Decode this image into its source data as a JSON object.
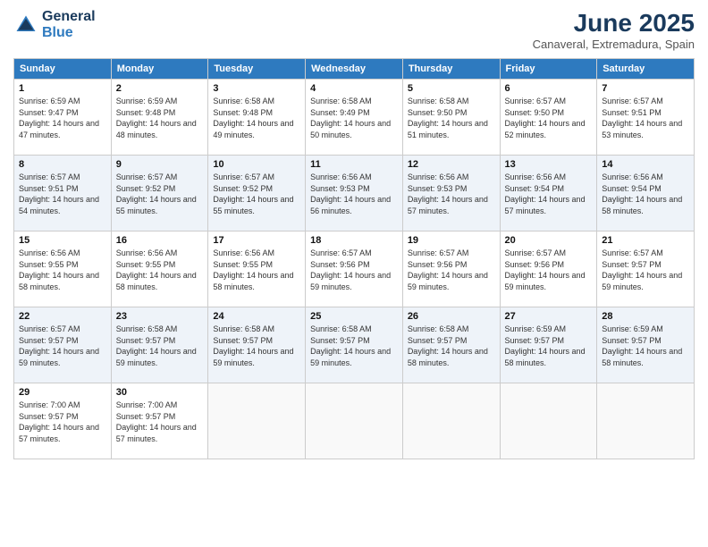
{
  "logo": {
    "line1": "General",
    "line2": "Blue"
  },
  "title": "June 2025",
  "location": "Canaveral, Extremadura, Spain",
  "headers": [
    "Sunday",
    "Monday",
    "Tuesday",
    "Wednesday",
    "Thursday",
    "Friday",
    "Saturday"
  ],
  "weeks": [
    [
      {
        "day": "1",
        "sunrise": "6:59 AM",
        "sunset": "9:47 PM",
        "daylight": "14 hours and 47 minutes."
      },
      {
        "day": "2",
        "sunrise": "6:59 AM",
        "sunset": "9:48 PM",
        "daylight": "14 hours and 48 minutes."
      },
      {
        "day": "3",
        "sunrise": "6:58 AM",
        "sunset": "9:48 PM",
        "daylight": "14 hours and 49 minutes."
      },
      {
        "day": "4",
        "sunrise": "6:58 AM",
        "sunset": "9:49 PM",
        "daylight": "14 hours and 50 minutes."
      },
      {
        "day": "5",
        "sunrise": "6:58 AM",
        "sunset": "9:50 PM",
        "daylight": "14 hours and 51 minutes."
      },
      {
        "day": "6",
        "sunrise": "6:57 AM",
        "sunset": "9:50 PM",
        "daylight": "14 hours and 52 minutes."
      },
      {
        "day": "7",
        "sunrise": "6:57 AM",
        "sunset": "9:51 PM",
        "daylight": "14 hours and 53 minutes."
      }
    ],
    [
      {
        "day": "8",
        "sunrise": "6:57 AM",
        "sunset": "9:51 PM",
        "daylight": "14 hours and 54 minutes."
      },
      {
        "day": "9",
        "sunrise": "6:57 AM",
        "sunset": "9:52 PM",
        "daylight": "14 hours and 55 minutes."
      },
      {
        "day": "10",
        "sunrise": "6:57 AM",
        "sunset": "9:52 PM",
        "daylight": "14 hours and 55 minutes."
      },
      {
        "day": "11",
        "sunrise": "6:56 AM",
        "sunset": "9:53 PM",
        "daylight": "14 hours and 56 minutes."
      },
      {
        "day": "12",
        "sunrise": "6:56 AM",
        "sunset": "9:53 PM",
        "daylight": "14 hours and 57 minutes."
      },
      {
        "day": "13",
        "sunrise": "6:56 AM",
        "sunset": "9:54 PM",
        "daylight": "14 hours and 57 minutes."
      },
      {
        "day": "14",
        "sunrise": "6:56 AM",
        "sunset": "9:54 PM",
        "daylight": "14 hours and 58 minutes."
      }
    ],
    [
      {
        "day": "15",
        "sunrise": "6:56 AM",
        "sunset": "9:55 PM",
        "daylight": "14 hours and 58 minutes."
      },
      {
        "day": "16",
        "sunrise": "6:56 AM",
        "sunset": "9:55 PM",
        "daylight": "14 hours and 58 minutes."
      },
      {
        "day": "17",
        "sunrise": "6:56 AM",
        "sunset": "9:55 PM",
        "daylight": "14 hours and 58 minutes."
      },
      {
        "day": "18",
        "sunrise": "6:57 AM",
        "sunset": "9:56 PM",
        "daylight": "14 hours and 59 minutes."
      },
      {
        "day": "19",
        "sunrise": "6:57 AM",
        "sunset": "9:56 PM",
        "daylight": "14 hours and 59 minutes."
      },
      {
        "day": "20",
        "sunrise": "6:57 AM",
        "sunset": "9:56 PM",
        "daylight": "14 hours and 59 minutes."
      },
      {
        "day": "21",
        "sunrise": "6:57 AM",
        "sunset": "9:57 PM",
        "daylight": "14 hours and 59 minutes."
      }
    ],
    [
      {
        "day": "22",
        "sunrise": "6:57 AM",
        "sunset": "9:57 PM",
        "daylight": "14 hours and 59 minutes."
      },
      {
        "day": "23",
        "sunrise": "6:58 AM",
        "sunset": "9:57 PM",
        "daylight": "14 hours and 59 minutes."
      },
      {
        "day": "24",
        "sunrise": "6:58 AM",
        "sunset": "9:57 PM",
        "daylight": "14 hours and 59 minutes."
      },
      {
        "day": "25",
        "sunrise": "6:58 AM",
        "sunset": "9:57 PM",
        "daylight": "14 hours and 59 minutes."
      },
      {
        "day": "26",
        "sunrise": "6:58 AM",
        "sunset": "9:57 PM",
        "daylight": "14 hours and 58 minutes."
      },
      {
        "day": "27",
        "sunrise": "6:59 AM",
        "sunset": "9:57 PM",
        "daylight": "14 hours and 58 minutes."
      },
      {
        "day": "28",
        "sunrise": "6:59 AM",
        "sunset": "9:57 PM",
        "daylight": "14 hours and 58 minutes."
      }
    ],
    [
      {
        "day": "29",
        "sunrise": "7:00 AM",
        "sunset": "9:57 PM",
        "daylight": "14 hours and 57 minutes."
      },
      {
        "day": "30",
        "sunrise": "7:00 AM",
        "sunset": "9:57 PM",
        "daylight": "14 hours and 57 minutes."
      },
      null,
      null,
      null,
      null,
      null
    ]
  ]
}
